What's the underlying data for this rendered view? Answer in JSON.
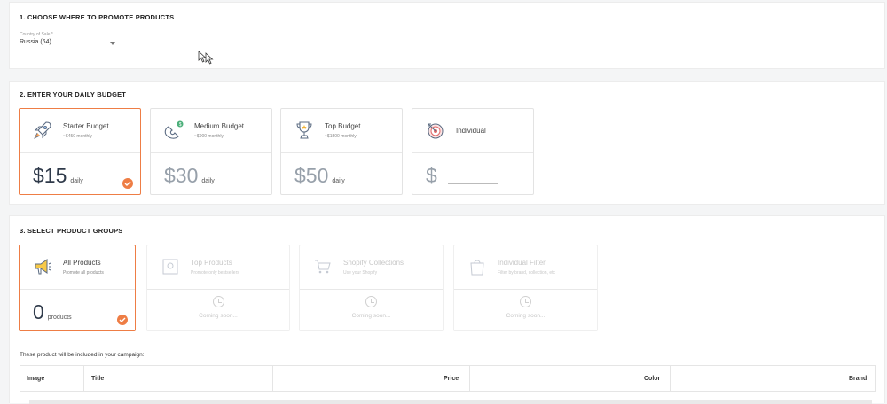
{
  "section1": {
    "title": "1. CHOOSE WHERE TO PROMOTE PRODUCTS",
    "country_label": "Country of Sale *",
    "country_value": "Russia (64)"
  },
  "section2": {
    "title": "2. ENTER YOUR DAILY BUDGET",
    "cards": [
      {
        "title": "Starter Budget",
        "sub": "~$450 monthly",
        "amount": "$15",
        "unit": "daily",
        "selected": true,
        "icon": "rocket-icon"
      },
      {
        "title": "Medium Budget",
        "sub": "~$900 monthly",
        "amount": "$30",
        "unit": "daily",
        "selected": false,
        "icon": "magnet-dollar-icon"
      },
      {
        "title": "Top Budget",
        "sub": "~$1500 monthly",
        "amount": "$50",
        "unit": "daily",
        "selected": false,
        "icon": "trophy-icon"
      },
      {
        "title": "Individual",
        "amount": "$",
        "selected": false,
        "icon": "target-icon"
      }
    ]
  },
  "section3": {
    "title": "3. SELECT PRODUCT GROUPS",
    "cards": [
      {
        "title": "All Products",
        "sub": "Promote all products",
        "amount": "0",
        "unit": "products",
        "selected": true,
        "icon": "megaphone-icon"
      },
      {
        "title": "Top Products",
        "sub": "Promote only bestsellers",
        "soon": "Coming soon...",
        "icon": "bestseller-icon"
      },
      {
        "title": "Shopify Collections",
        "sub": "Use your Shopify",
        "soon": "Coming soon...",
        "icon": "cart-icon"
      },
      {
        "title": "Individual Filter",
        "sub": "Filter by brand, collection, etc",
        "soon": "Coming soon...",
        "icon": "shopping-bag-icon"
      }
    ],
    "note": "These product will be included in your campaign:",
    "table_headers": [
      "Image",
      "Title",
      "Price",
      "Color",
      "Brand"
    ]
  },
  "colors": {
    "accent": "#ee7d45",
    "amount_text": "#2f3a4a"
  }
}
